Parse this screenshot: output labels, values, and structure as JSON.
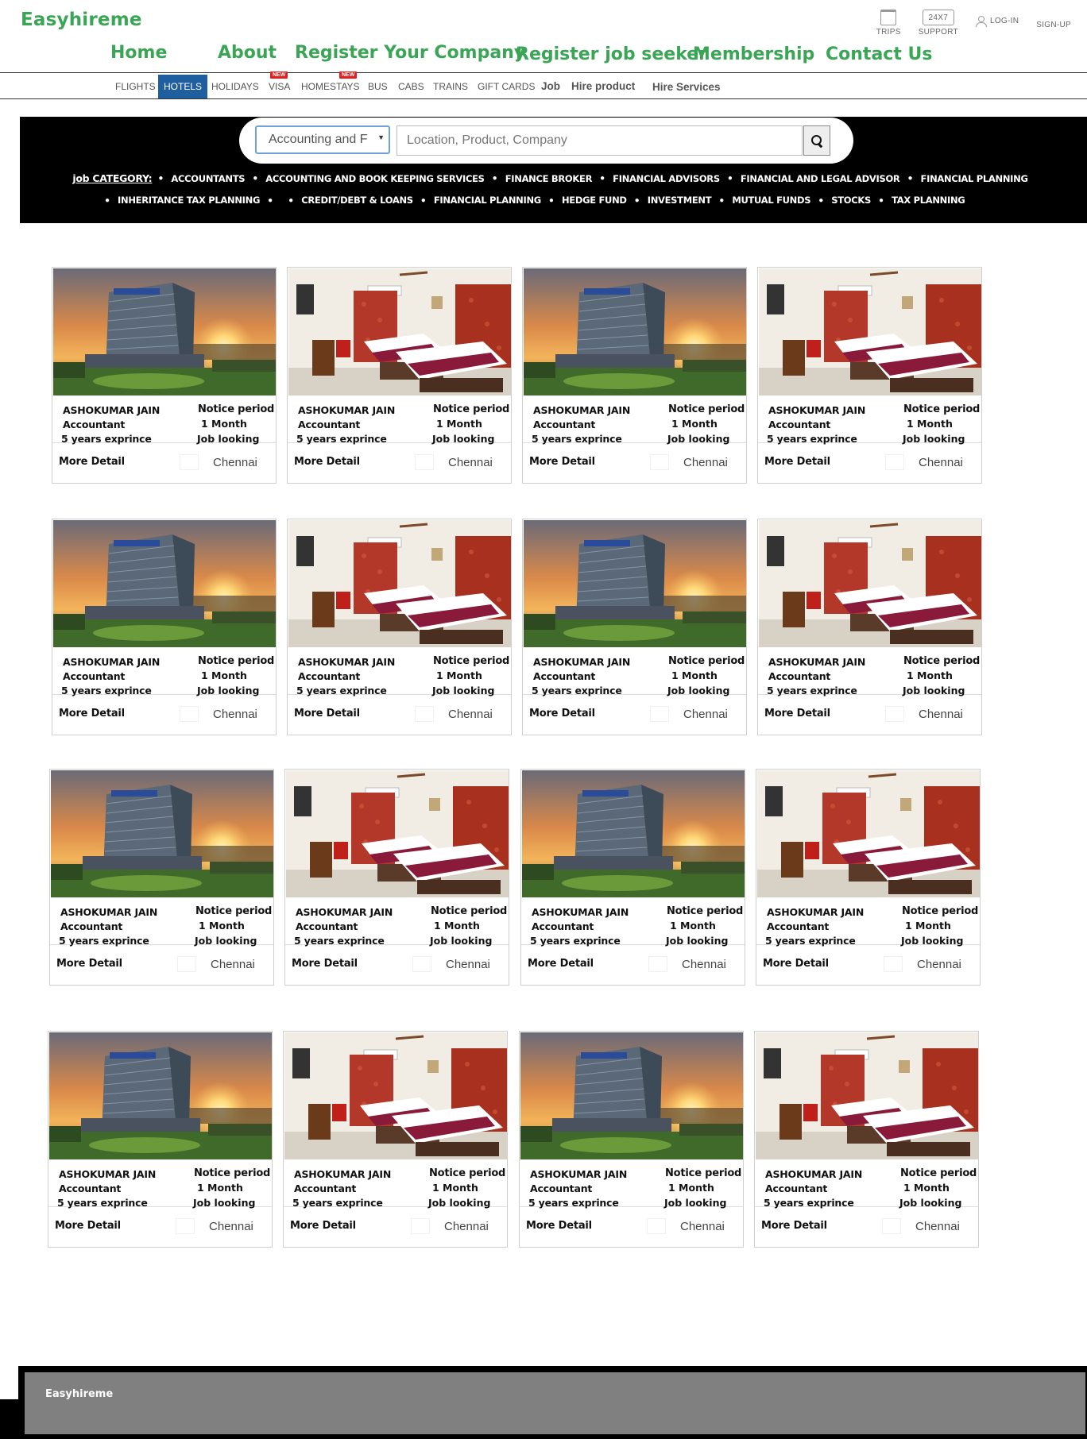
{
  "brand": "Easyhireme",
  "top_icons": {
    "trips": "TRIPS",
    "support_badge": "24X7",
    "support": "SUPPORT",
    "login": "LOG-IN",
    "signup": "SIGN-UP"
  },
  "main_nav": [
    "Home",
    "About",
    "Register Your Company",
    "Register job seeker",
    "Membership",
    "Contact Us"
  ],
  "sub_nav": {
    "items": [
      "FLIGHTS",
      "HOTELS",
      "HOLIDAYS",
      "VISA",
      "HOMESTAYS",
      "BUS",
      "CABS",
      "TRAINS",
      "GIFT CARDS",
      "Job",
      "Hire product",
      "Hire Services"
    ],
    "active": "HOTELS",
    "new_tag": "NEW"
  },
  "search": {
    "category_value": "Accounting and F",
    "location_placeholder": "Location, Product, Company"
  },
  "categories": {
    "label": "job CATEGORY:",
    "row1": [
      "ACCOUNTANTS",
      "ACCOUNTING AND BOOK KEEPING SERVICES",
      "FINANCE BROKER",
      "FINANCIAL ADVISORS",
      "FINANCIAL AND LEGAL ADVISOR",
      "FINANCIAL PLANNING"
    ],
    "row2": [
      "INHERITANCE TAX PLANNING",
      "",
      "CREDIT/DEBT & LOANS",
      "FINANCIAL PLANNING",
      "HEDGE FUND",
      "INVESTMENT",
      "MUTUAL FUNDS",
      "STOCKS",
      "TAX PLANNING"
    ]
  },
  "listing": {
    "name": "ASHOKUMAR JAIN",
    "role": "Accountant",
    "experience": "5 years exprince",
    "notice_label": "Notice period",
    "notice_value": "1 Month",
    "status": "Job looking",
    "more": "More Detail",
    "city": "Chennai"
  },
  "card_photos": [
    "hotel-exterior",
    "hotel-room",
    "hotel-exterior",
    "hotel-room"
  ],
  "footer": {
    "brand": "Easyhireme"
  }
}
